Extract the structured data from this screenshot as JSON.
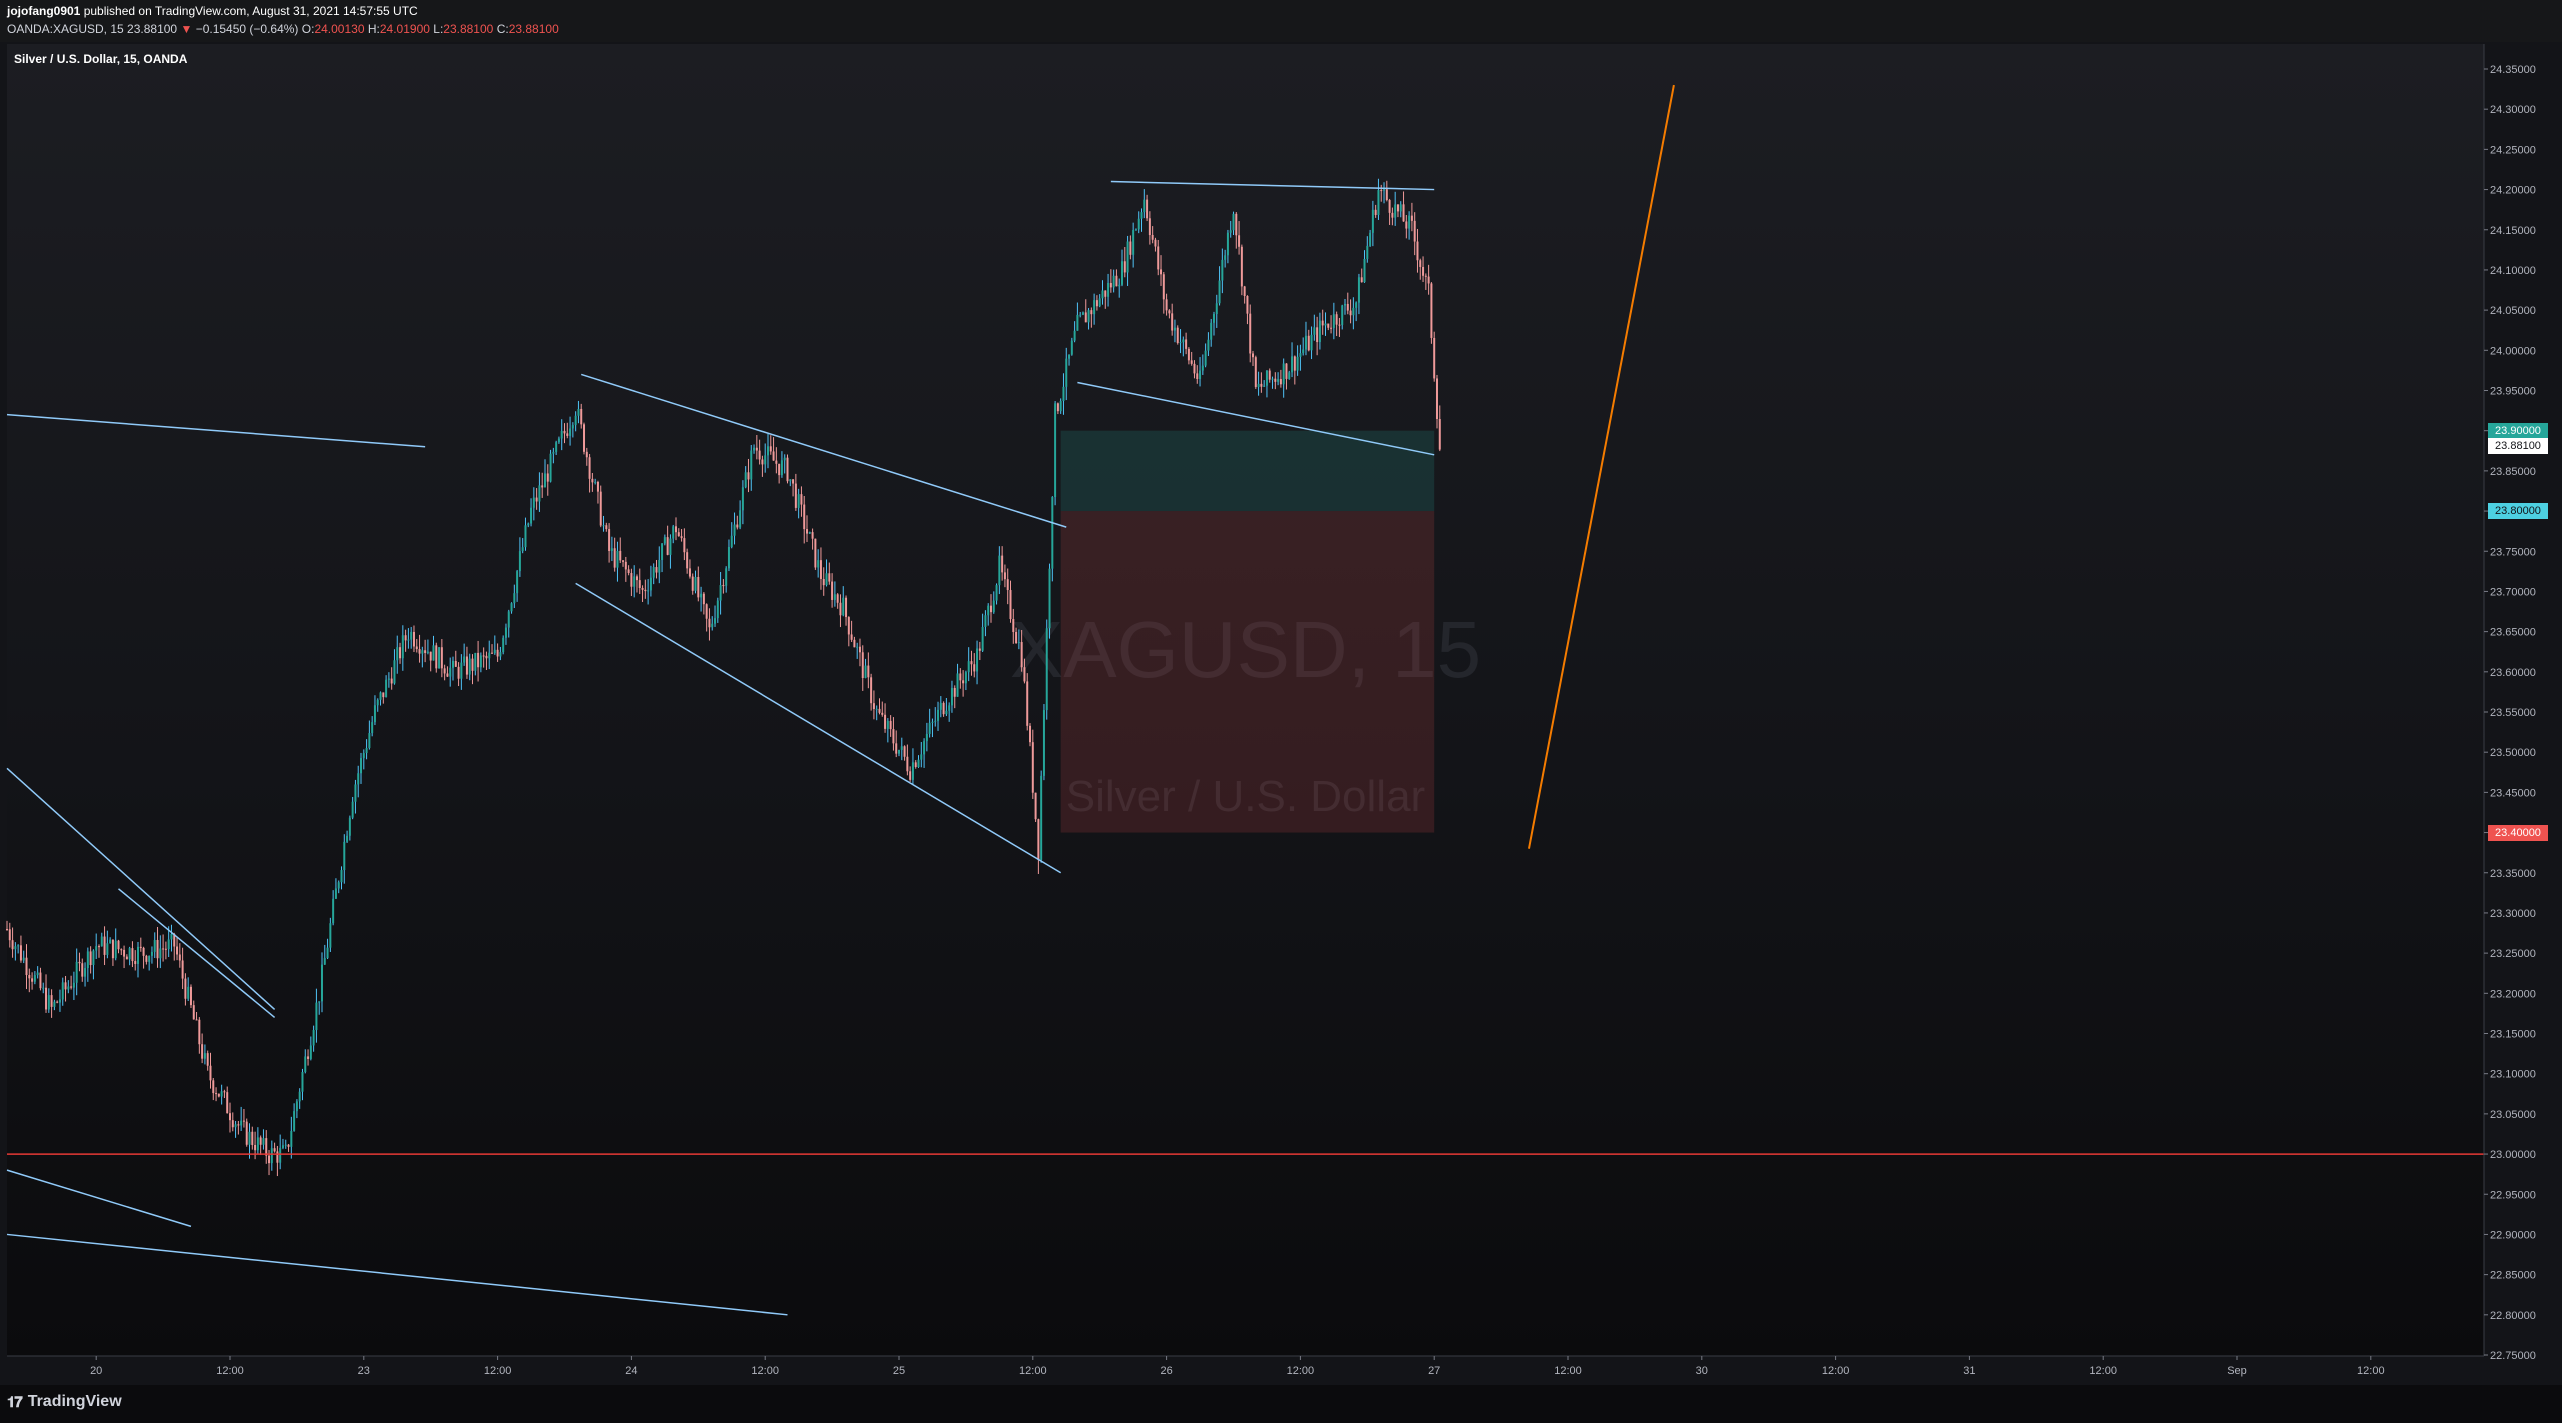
{
  "header": {
    "author": "jojofang0901",
    "published_text": "published on TradingView.com, August 31, 2021 14:57:55 UTC",
    "symbol_info": "OANDA:XAGUSD, 15",
    "last_price": "23.88100",
    "change_arrow": "▼",
    "change": "−0.15450 (−0.64%)",
    "ohlc": {
      "o_label": "O:",
      "o_value": "24.00130",
      "h_label": "H:",
      "h_value": "24.01900",
      "l_label": "L:",
      "l_value": "23.88100",
      "c_label": "C:",
      "c_value": "23.88100"
    }
  },
  "legend": "Silver / U.S. Dollar, 15, OANDA",
  "watermark": {
    "symbol": "XAGUSD, 15",
    "description": "Silver / U.S. Dollar"
  },
  "branding": "TradingView",
  "colors": {
    "up": "#26a69a",
    "up_wick": "#4fc3f7",
    "down": "#ef9a9a",
    "trendline": "#90caf9",
    "support": "#e53935",
    "projection": "#f57c00",
    "target_zone": "rgba(38,166,154,0.18)",
    "stop_zone": "rgba(239,83,80,0.16)"
  },
  "price_tags": {
    "target": "23.90000",
    "last": "23.88100",
    "entry": "23.80000",
    "stop": "23.40000"
  },
  "chart_data": {
    "type": "candlestick",
    "symbol": "XAGUSD",
    "interval": "15",
    "exchange": "OANDA",
    "y_range": [
      22.75,
      24.35
    ],
    "y_ticks": [
      "24.35000",
      "24.30000",
      "24.25000",
      "24.20000",
      "24.15000",
      "24.10000",
      "24.05000",
      "24.00000",
      "23.95000",
      "23.90000",
      "23.85000",
      "23.80000",
      "23.75000",
      "23.70000",
      "23.65000",
      "23.60000",
      "23.55000",
      "23.50000",
      "23.45000",
      "23.40000",
      "23.35000",
      "23.30000",
      "23.25000",
      "23.20000",
      "23.15000",
      "23.10000",
      "23.05000",
      "23.00000",
      "22.95000",
      "22.90000",
      "22.85000",
      "22.80000",
      "22.75000"
    ],
    "x_ticks": [
      "20",
      "12:00",
      "23",
      "12:00",
      "24",
      "12:00",
      "25",
      "12:00",
      "26",
      "12:00",
      "27",
      "12:00",
      "30",
      "12:00",
      "31",
      "12:00",
      "Sep",
      "12:00"
    ],
    "price_path": [
      [
        0,
        23.28
      ],
      [
        4,
        23.18
      ],
      [
        8,
        23.26
      ],
      [
        12,
        23.25
      ],
      [
        15,
        23.26
      ],
      [
        18,
        23.1
      ],
      [
        21,
        23.03
      ],
      [
        23.5,
        23.0
      ],
      [
        25,
        23.0
      ],
      [
        28,
        23.2
      ],
      [
        31,
        23.45
      ],
      [
        33,
        23.55
      ],
      [
        36,
        23.65
      ],
      [
        40,
        23.6
      ],
      [
        44,
        23.62
      ],
      [
        47,
        23.8
      ],
      [
        51,
        23.93
      ],
      [
        54,
        23.75
      ],
      [
        57,
        23.7
      ],
      [
        60,
        23.78
      ],
      [
        63,
        23.65
      ],
      [
        67,
        23.88
      ],
      [
        70,
        23.85
      ],
      [
        73,
        23.72
      ],
      [
        75,
        23.68
      ],
      [
        78,
        23.55
      ],
      [
        81,
        23.48
      ],
      [
        84,
        23.56
      ],
      [
        87,
        23.62
      ],
      [
        89,
        23.73
      ],
      [
        91,
        23.62
      ],
      [
        92.5,
        23.38
      ],
      [
        94,
        23.92
      ],
      [
        96,
        24.03
      ],
      [
        100,
        24.1
      ],
      [
        102,
        24.19
      ],
      [
        104,
        24.05
      ],
      [
        107,
        23.96
      ],
      [
        110,
        24.18
      ],
      [
        112,
        23.95
      ],
      [
        115,
        23.98
      ],
      [
        118,
        24.03
      ],
      [
        121,
        24.06
      ],
      [
        123,
        24.2
      ],
      [
        126,
        24.15
      ],
      [
        127.5,
        24.07
      ],
      [
        128.5,
        23.88
      ]
    ],
    "trendlines": [
      {
        "from": [
          0,
          23.92
        ],
        "to": [
          37.5,
          23.88
        ]
      },
      {
        "from": [
          0,
          23.48
        ],
        "to": [
          24,
          23.18
        ]
      },
      {
        "from": [
          10,
          23.33
        ],
        "to": [
          24,
          23.17
        ]
      },
      {
        "from": [
          0,
          22.98
        ],
        "to": [
          16.5,
          22.91
        ]
      },
      {
        "from": [
          0,
          22.9
        ],
        "to": [
          70,
          22.8
        ]
      },
      {
        "from": [
          51.5,
          23.97
        ],
        "to": [
          95,
          23.78
        ]
      },
      {
        "from": [
          51,
          23.71
        ],
        "to": [
          94.5,
          23.35
        ]
      },
      {
        "from": [
          96,
          23.96
        ],
        "to": [
          128,
          23.87
        ]
      },
      {
        "from": [
          99,
          24.21
        ],
        "to": [
          128,
          24.2
        ]
      }
    ],
    "support_level": 23.0,
    "position": {
      "x_start": 94.5,
      "x_end": 128,
      "target": 23.9,
      "entry": 23.8,
      "stop": 23.4
    },
    "projection": {
      "from": [
        136.5,
        23.38
      ],
      "to": [
        149.5,
        24.33
      ]
    }
  }
}
